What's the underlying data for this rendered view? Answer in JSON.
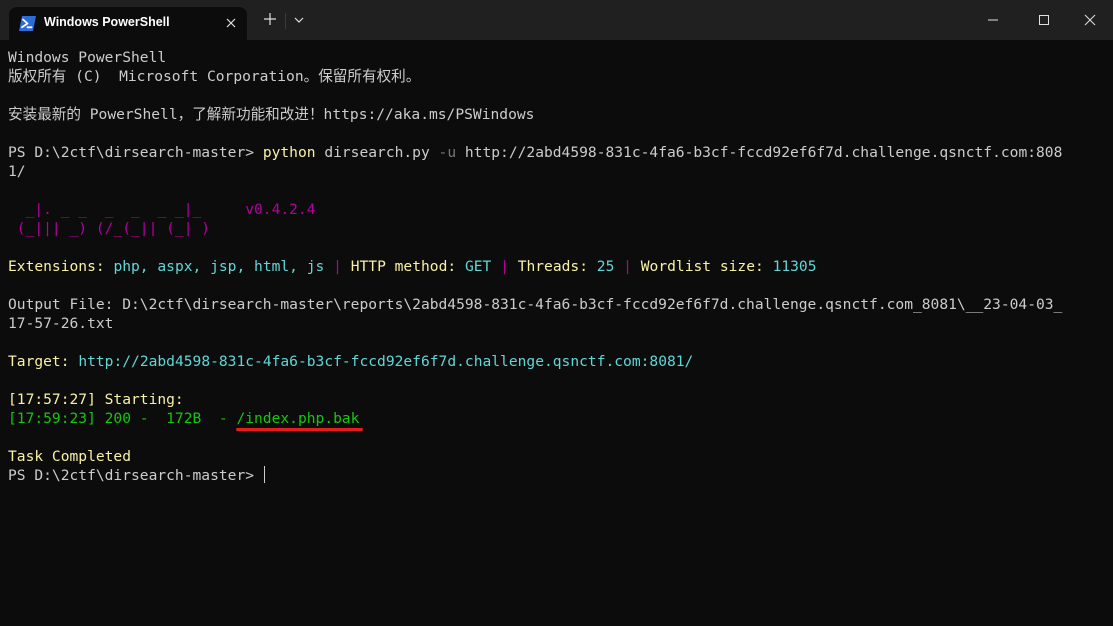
{
  "window": {
    "tab_title": "Windows PowerShell",
    "icons": {
      "tab": "powershell-icon",
      "close": "close-icon",
      "new_tab": "plus-icon",
      "dropdown": "chevron-down-icon",
      "minimize": "minimize-icon",
      "maximize": "maximize-icon",
      "win_close": "close-icon"
    }
  },
  "colors": {
    "yellow": "#f9f1a5",
    "cyan": "#61d6d6",
    "magenta": "#b4009e",
    "green": "#16c60c",
    "gray": "#767676",
    "text": "#cccccc",
    "underline": "#e41c1c"
  },
  "terminal": {
    "header1": "Windows PowerShell",
    "header2": "版权所有 (C)  Microsoft Corporation。保留所有权利。",
    "install": "安装最新的 PowerShell，了解新功能和改进！https://aka.ms/PSWindows",
    "cmd": {
      "prompt": "PS D:\\2ctf\\dirsearch-master> ",
      "exe": "python",
      "script": " dirsearch.py ",
      "flag": "-u",
      "url_part1": " http://2abd4598-831c-4fa6-b3cf-fccd92ef6f7d.challenge.qsnctf.com:808",
      "url_part2": "1/"
    },
    "logo": {
      "line1": "  _|. _ _  _  _  _ _|_",
      "version": "v0.4.2.4",
      "line2": " (_||| _) (/_(_|| (_| )"
    },
    "config": {
      "ext_label": "Extensions:",
      "ext_value": "php, aspx, jsp, html, js",
      "method_label": "HTTP method:",
      "method_value": "GET",
      "threads_label": "Threads:",
      "threads_value": "25",
      "wordlist_label": "Wordlist size:",
      "wordlist_value": "11305",
      "sep": "|"
    },
    "output_file_1": "Output File: D:\\2ctf\\dirsearch-master\\reports\\2abd4598-831c-4fa6-b3cf-fccd92ef6f7d.challenge.qsnctf.com_8081\\__23-04-03_",
    "output_file_2": "17-57-26.txt",
    "target_label": "Target:",
    "target_url": "http://2abd4598-831c-4fa6-b3cf-fccd92ef6f7d.challenge.qsnctf.com:8081/",
    "starting": "[17:57:27] Starting:",
    "result_prefix": "[17:59:23] 200 -  172B  - ",
    "result_path": "/index.php.bak",
    "task_completed": "Task Completed",
    "final_prompt": "PS D:\\2ctf\\dirsearch-master> "
  }
}
